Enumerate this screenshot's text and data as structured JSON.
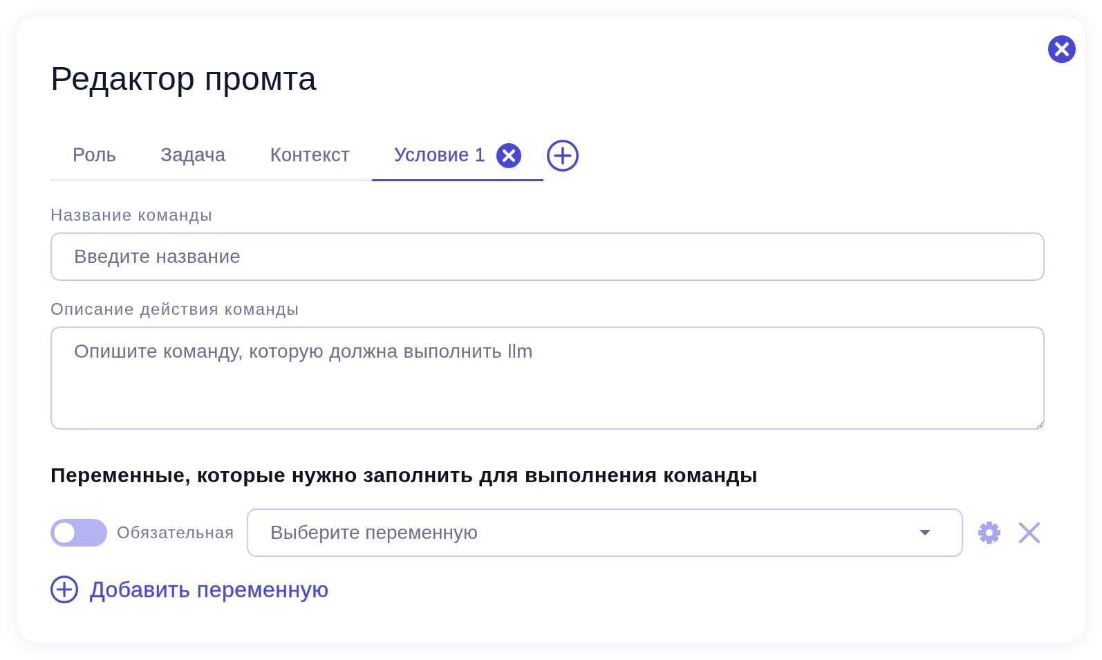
{
  "dialog": {
    "title": "Редактор промта"
  },
  "tabs": [
    {
      "label": "Роль",
      "selected": false,
      "closable": false
    },
    {
      "label": "Задача",
      "selected": false,
      "closable": false
    },
    {
      "label": "Контекст",
      "selected": false,
      "closable": false
    },
    {
      "label": "Условие 1",
      "selected": true,
      "closable": true
    }
  ],
  "fields": [
    {
      "kind": "input",
      "label": "Название команды",
      "placeholder": "Введите название"
    },
    {
      "kind": "textarea",
      "label": "Описание действия команды",
      "placeholder": "Опишите команду, которую должна выполнить llm"
    }
  ],
  "variables": {
    "heading": "Переменные, которые нужно заполнить для выполнения команды",
    "rows": [
      {
        "required": false,
        "required_label": "Обязательная",
        "placeholder": "Выберите переменную"
      }
    ],
    "add_label": "Добавить переменную"
  }
}
